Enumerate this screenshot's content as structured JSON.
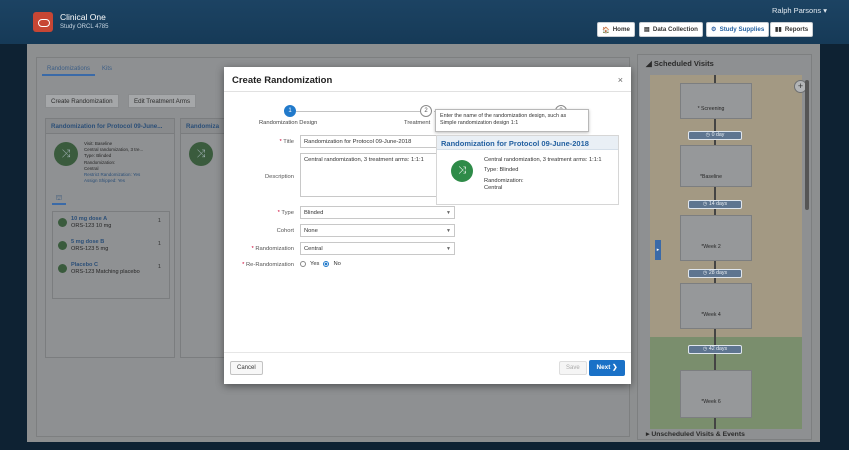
{
  "app": {
    "title": "Clinical One",
    "subtitle": "Study ORCL 4785",
    "user": "Ralph Parsons"
  },
  "header_buttons": [
    {
      "label": "Home",
      "icon": "home-icon"
    },
    {
      "label": "Data Collection",
      "icon": "clipboard-icon"
    },
    {
      "label": "Study Supplies",
      "icon": "supplies-icon"
    },
    {
      "label": "Reports",
      "icon": "bar-chart-icon"
    }
  ],
  "left_panel": {
    "tabs": [
      "Randomizations",
      "Kits"
    ],
    "toolbar": {
      "create": "Create Randomization",
      "edit_arms": "Edit Treatment Arms"
    },
    "card": {
      "title": "Randomization for Protocol 09-June...",
      "info": [
        "Visit: Baseline",
        "Central randomization, 3 tre...",
        "Type: Blinded",
        "Randomization:",
        "Central",
        "Restrict Randomization: Yes",
        "Assign Shipped: Yes"
      ],
      "arms": [
        {
          "name": "10 mg dose A",
          "detail": "ORS-123 10 mg",
          "num": "1"
        },
        {
          "name": "5 mg dose B",
          "detail": "ORS-123 5 mg",
          "num": "1"
        },
        {
          "name": "Placebo C",
          "detail": "ORS-123 Matching placebo",
          "num": "1"
        }
      ],
      "second_title": "Randomiza"
    }
  },
  "scheduled_visits": {
    "title": "Scheduled Visits",
    "visits": [
      "* Screening",
      "*Baseline",
      "*Week 2",
      "*Week 4",
      "*Week 6"
    ],
    "intervals": [
      "0 day",
      "14 days",
      "28 days",
      "42 days"
    ],
    "unscheduled": "Unscheduled Visits & Events"
  },
  "modal": {
    "title": "Create Randomization",
    "close": "×",
    "steps": [
      {
        "num": "1",
        "label": "Randomization Design"
      },
      {
        "num": "2",
        "label": "Treatment"
      },
      {
        "num": "3",
        "label": ""
      }
    ],
    "tooltip": "Enter the name of the randomization design, such as Simple randomization design 1:1",
    "fields": {
      "title_label": "Title",
      "title_value": "Randomization for Protocol 09-June-2018",
      "description_label": "Description",
      "description_value": "Central randomization, 3 treatment arms: 1:1:1",
      "type_label": "Type",
      "type_value": "Blinded",
      "cohort_label": "Cohort",
      "cohort_value": "None",
      "randomization_label": "Randomization",
      "randomization_value": "Central",
      "rerandomization_label": "Re-Randomization",
      "yes": "Yes",
      "no": "No"
    },
    "preview": {
      "title": "Randomization for Protocol 09-June-2018",
      "line1": "Central randomization, 3 treatment arms: 1:1:1",
      "line2": "Type: Blinded",
      "line3": "Randomization:",
      "line4": "Central"
    },
    "buttons": {
      "cancel": "Cancel",
      "save": "Save",
      "next": "Next"
    }
  },
  "colors": {
    "header": "#163a57",
    "accent": "#227acb",
    "logo": "#c74634"
  }
}
